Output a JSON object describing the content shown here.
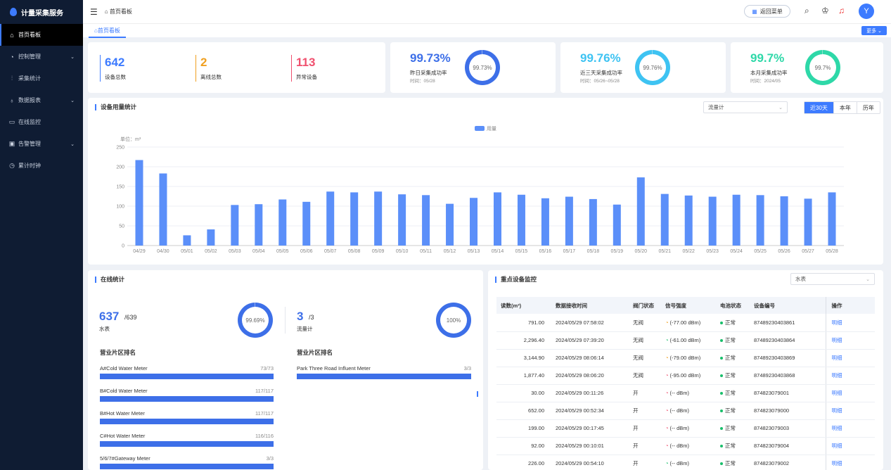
{
  "app": {
    "title": "计量采集服务"
  },
  "sidebar": {
    "items": [
      {
        "label": "首页看板",
        "icon": "home-icon",
        "active": true,
        "chevron": false
      },
      {
        "label": "控制管理",
        "icon": "control-icon",
        "chevron": true
      },
      {
        "label": "采集统计",
        "icon": "stats-icon",
        "chevron": false
      },
      {
        "label": "数据报表",
        "icon": "report-icon",
        "chevron": true
      },
      {
        "label": "在线监控",
        "icon": "monitor-icon",
        "chevron": false
      },
      {
        "label": "告警管理",
        "icon": "alarm-icon",
        "chevron": true
      },
      {
        "label": "累计时钟",
        "icon": "clock-icon",
        "chevron": false
      }
    ]
  },
  "topbar": {
    "breadcrumb": "首页看板",
    "back_label": "返回菜单",
    "avatar": "Y"
  },
  "tabs": {
    "active": "首页看板",
    "more": "更多"
  },
  "stats": {
    "total": {
      "value": "642",
      "label": "设备总数",
      "color": "#3d7bff"
    },
    "offline": {
      "value": "2",
      "label": "离线总数",
      "color": "#f0a020"
    },
    "abnormal": {
      "value": "113",
      "label": "异常设备",
      "color": "#f0506e"
    }
  },
  "rates": [
    {
      "value": "99.73%",
      "label": "昨日采集成功率",
      "time": "时间：05/28",
      "ring_text": "99.73%",
      "color": "#3d6fe8",
      "percent": 99.73
    },
    {
      "value": "99.76%",
      "label": "近三天采集成功率",
      "time": "时间：05/26~05/28",
      "ring_text": "99.76%",
      "color": "#3ec3f2",
      "percent": 99.76
    },
    {
      "value": "99.7%",
      "label": "本月采集成功率",
      "time": "时间：2024/05",
      "ring_text": "99.7%",
      "color": "#2ed8a8",
      "percent": 99.7
    }
  ],
  "usage": {
    "title": "设备用量统计",
    "select": "流量计",
    "ranges": [
      "近30天",
      "本年",
      "历年"
    ],
    "active_range": "近30天"
  },
  "chart_data": {
    "type": "bar",
    "legend": "用量",
    "unit_label": "单位：m³",
    "ylim": [
      0,
      250
    ],
    "yticks": [
      "0",
      "50",
      "100",
      "150",
      "200",
      "250"
    ],
    "categories": [
      "04/29",
      "04/30",
      "05/01",
      "05/02",
      "05/03",
      "05/04",
      "05/05",
      "05/06",
      "05/07",
      "05/08",
      "05/09",
      "05/10",
      "05/11",
      "05/12",
      "05/13",
      "05/14",
      "05/15",
      "05/16",
      "05/17",
      "05/18",
      "05/19",
      "05/20",
      "05/21",
      "05/22",
      "05/23",
      "05/24",
      "05/25",
      "05/26",
      "05/27",
      "05/28"
    ],
    "values": [
      217,
      183,
      26,
      41,
      103,
      105,
      117,
      111,
      137,
      135,
      137,
      130,
      128,
      106,
      121,
      135,
      129,
      120,
      124,
      118,
      104,
      173,
      131,
      127,
      124,
      129,
      128,
      125,
      119,
      135
    ],
    "color": "#5b8ff9"
  },
  "online": {
    "title": "在线统计",
    "water": {
      "count": "637",
      "total": "/639",
      "label": "水表",
      "ring": "99.69%",
      "percent": 99.69
    },
    "flow": {
      "count": "3",
      "total": "/3",
      "label": "流量计",
      "ring": "100%",
      "percent": 100
    },
    "rank_title_left": "营业片区排名",
    "rank_title_right": "营业片区排名",
    "rank_left": [
      {
        "name": "A#Cold Water Meter",
        "value": "73/73",
        "ratio": 1
      },
      {
        "name": "B#Cold Water Meter",
        "value": "117/117",
        "ratio": 1
      },
      {
        "name": "B#Hot Water Meter",
        "value": "117/117",
        "ratio": 1
      },
      {
        "name": "C#Hot Water Meter",
        "value": "116/116",
        "ratio": 1
      },
      {
        "name": "5/6/7#Gateway Meter",
        "value": "3/3",
        "ratio": 1
      }
    ],
    "rank_right": [
      {
        "name": "Park Three Road Influent Meter",
        "value": "3/3",
        "ratio": 1
      }
    ]
  },
  "monitor": {
    "title": "重点设备监控",
    "select": "水表",
    "headers": [
      "读数(m³)",
      "数据接收时间",
      "阀门状态",
      "信号强度",
      "电池状态",
      "设备编号",
      "操作"
    ],
    "rows": [
      {
        "reading": "791.00",
        "time": "2024/05/29 07:58:02",
        "valve": "无阀",
        "signal": "(-77.00 dBm)",
        "sig_color": "#f0a020",
        "battery": "正常",
        "device": "87489230403861",
        "action": "明细"
      },
      {
        "reading": "2,296.40",
        "time": "2024/05/29 07:39:20",
        "valve": "无阀",
        "signal": "(-61.00 dBm)",
        "sig_color": "#19be6b",
        "battery": "正常",
        "device": "87489230403864",
        "action": "明细"
      },
      {
        "reading": "3,144.90",
        "time": "2024/05/29 08:06:14",
        "valve": "无阀",
        "signal": "(-79.00 dBm)",
        "sig_color": "#f0a020",
        "battery": "正常",
        "device": "87489230403869",
        "action": "明细"
      },
      {
        "reading": "1,877.40",
        "time": "2024/05/29 08:06:20",
        "valve": "无阀",
        "signal": "(-95.00 dBm)",
        "sig_color": "#f0506e",
        "battery": "正常",
        "device": "87489230403868",
        "action": "明细"
      },
      {
        "reading": "30.00",
        "time": "2024/05/29 00:11:26",
        "valve": "开",
        "signal": "(-- dBm)",
        "sig_color": "#f0506e",
        "battery": "正常",
        "device": "874823079001",
        "action": "明细"
      },
      {
        "reading": "652.00",
        "time": "2024/05/29 00:52:34",
        "valve": "开",
        "signal": "(-- dBm)",
        "sig_color": "#f0506e",
        "battery": "正常",
        "device": "874823079000",
        "action": "明细"
      },
      {
        "reading": "199.00",
        "time": "2024/05/29 00:17:45",
        "valve": "开",
        "signal": "(-- dBm)",
        "sig_color": "#f0506e",
        "battery": "正常",
        "device": "874823079003",
        "action": "明细"
      },
      {
        "reading": "92.00",
        "time": "2024/05/29 00:10:01",
        "valve": "开",
        "signal": "(-- dBm)",
        "sig_color": "#f0506e",
        "battery": "正常",
        "device": "874823079004",
        "action": "明细"
      },
      {
        "reading": "226.00",
        "time": "2024/05/29 00:54:10",
        "valve": "开",
        "signal": "(-- dBm)",
        "sig_color": "#19be6b",
        "battery": "正常",
        "device": "874823079002",
        "action": "明细"
      }
    ]
  }
}
